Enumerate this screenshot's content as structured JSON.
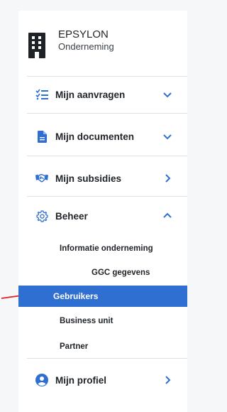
{
  "company": {
    "name": "EPSYLON",
    "type": "Onderneming"
  },
  "nav": {
    "aanvragen": {
      "label": "Mijn aanvragen",
      "icon": "list-check-icon",
      "chevron": "chevron-down-icon"
    },
    "documenten": {
      "label": "Mijn documenten",
      "icon": "document-icon",
      "chevron": "chevron-down-icon"
    },
    "subsidies": {
      "label": "Mijn subsidies",
      "icon": "handshake-icon",
      "chevron": "chevron-right-icon"
    },
    "beheer": {
      "label": "Beheer",
      "icon": "gear-icon",
      "chevron": "chevron-up-icon",
      "items": [
        {
          "label": "Informatie onderneming",
          "level": 1
        },
        {
          "label": "GGC gegevens",
          "level": 2
        },
        {
          "label": "Gebruikers",
          "level": 1,
          "active": true
        },
        {
          "label": "Business unit",
          "level": 1
        },
        {
          "label": "Partner",
          "level": 1
        }
      ]
    },
    "profiel": {
      "label": "Mijn profiel",
      "icon": "user-circle-icon",
      "chevron": "chevron-right-icon"
    }
  },
  "colors": {
    "accent": "#2f6fd1",
    "annotation_arrow": "#e02020"
  }
}
